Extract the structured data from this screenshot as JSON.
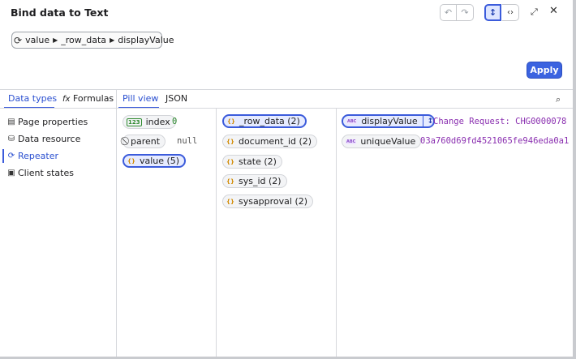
{
  "header": {
    "title": "Bind data to Text",
    "icons": {
      "undo": "undo-icon",
      "redo": "redo-icon",
      "vertical": "vertical-arrows-icon",
      "code": "code-icon",
      "expand": "expand-icon",
      "close": "close-icon"
    }
  },
  "path": {
    "segments": [
      "value",
      "_row_data",
      "displayValue"
    ]
  },
  "apply_label": "Apply",
  "tabs": {
    "data_types": "Data types",
    "formulas": "Formulas",
    "pill_view": "Pill view",
    "json": "JSON"
  },
  "nav": [
    {
      "label": "Page properties",
      "icon": "page-icon"
    },
    {
      "label": "Data resource",
      "icon": "database-icon"
    },
    {
      "label": "Repeater",
      "icon": "repeat-icon",
      "active": true
    },
    {
      "label": "Client states",
      "icon": "state-icon"
    }
  ],
  "col1": [
    {
      "label": "index",
      "type": "number",
      "value": "0"
    },
    {
      "label": "parent",
      "type": "null",
      "value": "null"
    },
    {
      "label": "value (5)",
      "type": "object",
      "selected": true
    }
  ],
  "col2": [
    {
      "label": "_row_data (2)",
      "type": "object",
      "selected": true
    },
    {
      "label": "document_id (2)",
      "type": "object"
    },
    {
      "label": "state (2)",
      "type": "object"
    },
    {
      "label": "sys_id (2)",
      "type": "object"
    },
    {
      "label": "sysapproval (2)",
      "type": "object"
    }
  ],
  "col3": [
    {
      "label": "displayValue",
      "type": "string",
      "selected": true,
      "value": "Change Request: CHG0000078"
    },
    {
      "label": "uniqueValue",
      "type": "string",
      "value": "03a760d69fd4521065fe946eda0a1"
    }
  ],
  "colors": {
    "accent": "#3b5bdb",
    "apply": "#3b63e0",
    "string_value": "#8a2fb0",
    "number_value": "#2f8a2f",
    "object_icon": "#d28a00"
  }
}
